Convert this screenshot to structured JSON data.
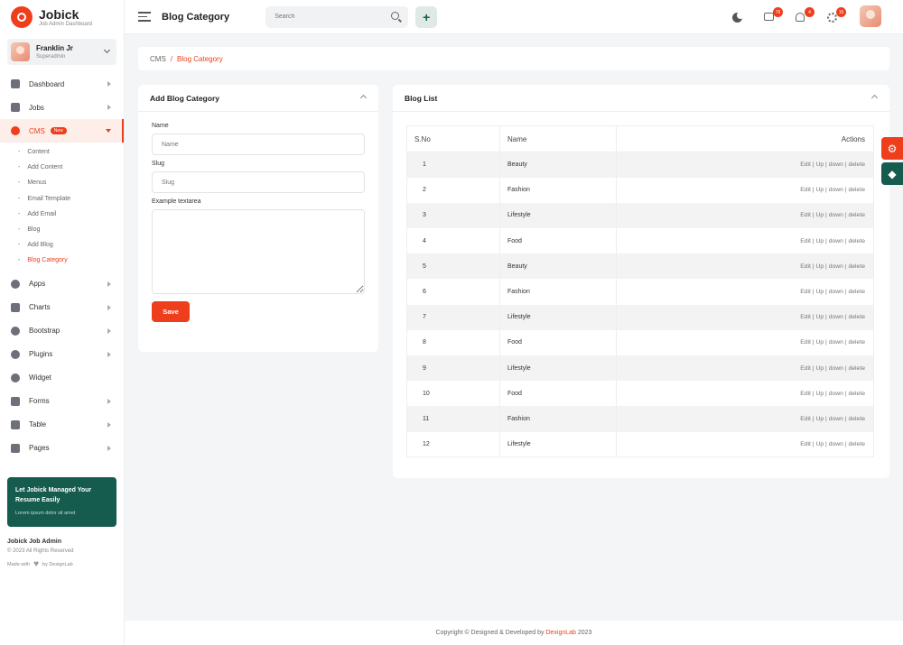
{
  "brand": {
    "title": "Jobick",
    "subtitle": "Job Admin Dashboard"
  },
  "user": {
    "name": "Franklin Jr",
    "role": "Superadmin"
  },
  "nav": {
    "dashboard": "Dashboard",
    "jobs": "Jobs",
    "cms": "CMS",
    "cms_badge": "New",
    "cms_sub": [
      "Content",
      "Add Content",
      "Menus",
      "Email Template",
      "Add Email",
      "Blog",
      "Add Blog",
      "Blog Category"
    ],
    "apps": "Apps",
    "charts": "Charts",
    "bootstrap": "Bootstrap",
    "plugins": "Plugins",
    "widget": "Widget",
    "forms": "Forms",
    "table": "Table",
    "pages": "Pages"
  },
  "promo": {
    "title": "Let Jobick Managed Your Resume Easily",
    "text": "Lorem ipsum dolor sit amet"
  },
  "sidebar_footer": {
    "title": "Jobick Job Admin",
    "copyright": "© 2023 All Rights Reserved",
    "made_with": "Made with",
    "by": "by DexignLab"
  },
  "header": {
    "page_title": "Blog Category",
    "search_placeholder": "Search",
    "plus": "+",
    "badges": {
      "chat": "76",
      "bell": "4",
      "gear": "15"
    }
  },
  "breadcrumb": {
    "root": "CMS",
    "sep": "/",
    "current": "Blog Category"
  },
  "add_form": {
    "title": "Add Blog Category",
    "name_label": "Name",
    "name_placeholder": "Name",
    "slug_label": "Slug",
    "slug_placeholder": "Slug",
    "textarea_label": "Example textarea",
    "save_label": "Save"
  },
  "blog_list": {
    "title": "Blog List",
    "columns": {
      "sno": "S.No",
      "name": "Name",
      "actions": "Actions"
    },
    "action_text": "Edit | Up | down | delete",
    "rows": [
      {
        "sno": "1",
        "name": "Beauty"
      },
      {
        "sno": "2",
        "name": "Fashion"
      },
      {
        "sno": "3",
        "name": "Lifestyle"
      },
      {
        "sno": "4",
        "name": "Food"
      },
      {
        "sno": "5",
        "name": "Beauty"
      },
      {
        "sno": "6",
        "name": "Fashion"
      },
      {
        "sno": "7",
        "name": "Lifestyle"
      },
      {
        "sno": "8",
        "name": "Food"
      },
      {
        "sno": "9",
        "name": "Lifestyle"
      },
      {
        "sno": "10",
        "name": "Food"
      },
      {
        "sno": "11",
        "name": "Fashion"
      },
      {
        "sno": "12",
        "name": "Lifestyle"
      }
    ]
  },
  "footer": {
    "text": "Copyright © Designed & Developed by",
    "brand": "DexignLab",
    "year": "2023"
  },
  "colors": {
    "accent": "#ef3e1c",
    "green": "#165c4e"
  }
}
